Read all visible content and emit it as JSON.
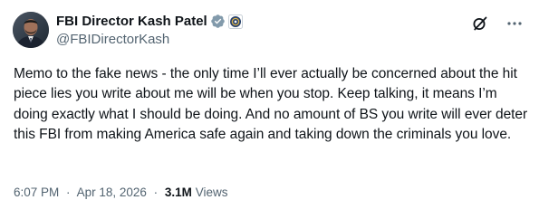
{
  "author": {
    "display_name": "FBI Director Kash Patel",
    "handle": "@FBIDirectorKash",
    "verified_badge_color": "#829aab"
  },
  "tweet": {
    "text": "Memo to the fake news - the only time I’ll ever actually be concerned about the hit piece lies you write about me will be when you stop. Keep talking, it means I’m doing exactly what I should be doing. And no amount of BS you write will ever deter this FBI from making America safe again and taking down the criminals you love.",
    "time": "6:07 PM",
    "separator": "·",
    "date": "Apr 18, 2026",
    "views_count": "3.1M",
    "views_label": "Views"
  },
  "icons": {
    "verified": "verified-badge-icon",
    "affiliate": "government-seal-icon",
    "grok": "grok-icon",
    "more": "more-options-icon"
  },
  "colors": {
    "text_primary": "#0f1419",
    "text_secondary": "#536471",
    "badge_gray": "#829aab"
  }
}
